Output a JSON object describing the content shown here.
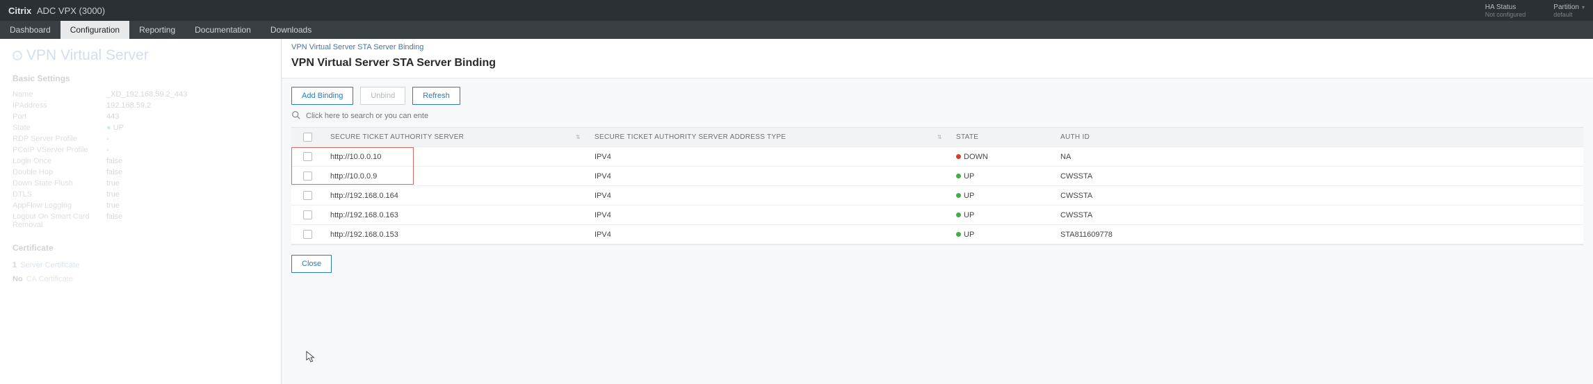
{
  "topbar": {
    "brand_main": "Citrix",
    "brand_sub": "ADC VPX (3000)",
    "ha_label": "HA Status",
    "ha_value": "Not configured",
    "partition_label": "Partition",
    "partition_value": "default"
  },
  "nav": {
    "tabs": [
      "Dashboard",
      "Configuration",
      "Reporting",
      "Documentation",
      "Downloads"
    ],
    "active": "Configuration"
  },
  "left": {
    "page_title": "VPN Virtual Server",
    "basic_settings_title": "Basic Settings",
    "rows": [
      {
        "k": "Name",
        "v": "_XD_192.168.59.2_443"
      },
      {
        "k": "IPAddress",
        "v": "192.168.59.2"
      },
      {
        "k": "Port",
        "v": "443"
      },
      {
        "k": "State",
        "v": "UP",
        "state": "up"
      },
      {
        "k": "RDP Server Profile",
        "v": "-"
      },
      {
        "k": "PCoIP VServer Profile",
        "v": "-"
      },
      {
        "k": "Login Once",
        "v": "false"
      },
      {
        "k": "Double Hop",
        "v": "false"
      },
      {
        "k": "Down State Flush",
        "v": "true"
      },
      {
        "k": "DTLS",
        "v": "true"
      },
      {
        "k": "AppFlow Logging",
        "v": "true"
      },
      {
        "k": "Logout On Smart Card Removal",
        "v": "false"
      }
    ],
    "certificate_title": "Certificate",
    "cert1_count": "1",
    "cert1_label": "Server Certificate",
    "cert2_count": "No",
    "cert2_label": "CA Certificate"
  },
  "panel": {
    "breadcrumb": "VPN Virtual Server STA Server Binding",
    "title": "VPN Virtual Server STA Server Binding",
    "buttons": {
      "add": "Add Binding",
      "unbind": "Unbind",
      "refresh": "Refresh",
      "close": "Close"
    },
    "search_placeholder": "Click here to search or you can ente",
    "columns": {
      "server": "SECURE TICKET AUTHORITY SERVER",
      "type": "SECURE TICKET AUTHORITY SERVER ADDRESS TYPE",
      "state": "STATE",
      "auth": "AUTH ID"
    },
    "rows": [
      {
        "server": "http://10.0.0.10",
        "type": "IPV4",
        "state": "DOWN",
        "auth": "NA",
        "highlight": true
      },
      {
        "server": "http://10.0.0.9",
        "type": "IPV4",
        "state": "UP",
        "auth": "CWSSTA",
        "highlight": true
      },
      {
        "server": "http://192.168.0.164",
        "type": "IPV4",
        "state": "UP",
        "auth": "CWSSTA"
      },
      {
        "server": "http://192.168.0.163",
        "type": "IPV4",
        "state": "UP",
        "auth": "CWSSTA"
      },
      {
        "server": "http://192.168.0.153",
        "type": "IPV4",
        "state": "UP",
        "auth": "STA811609778"
      }
    ]
  }
}
